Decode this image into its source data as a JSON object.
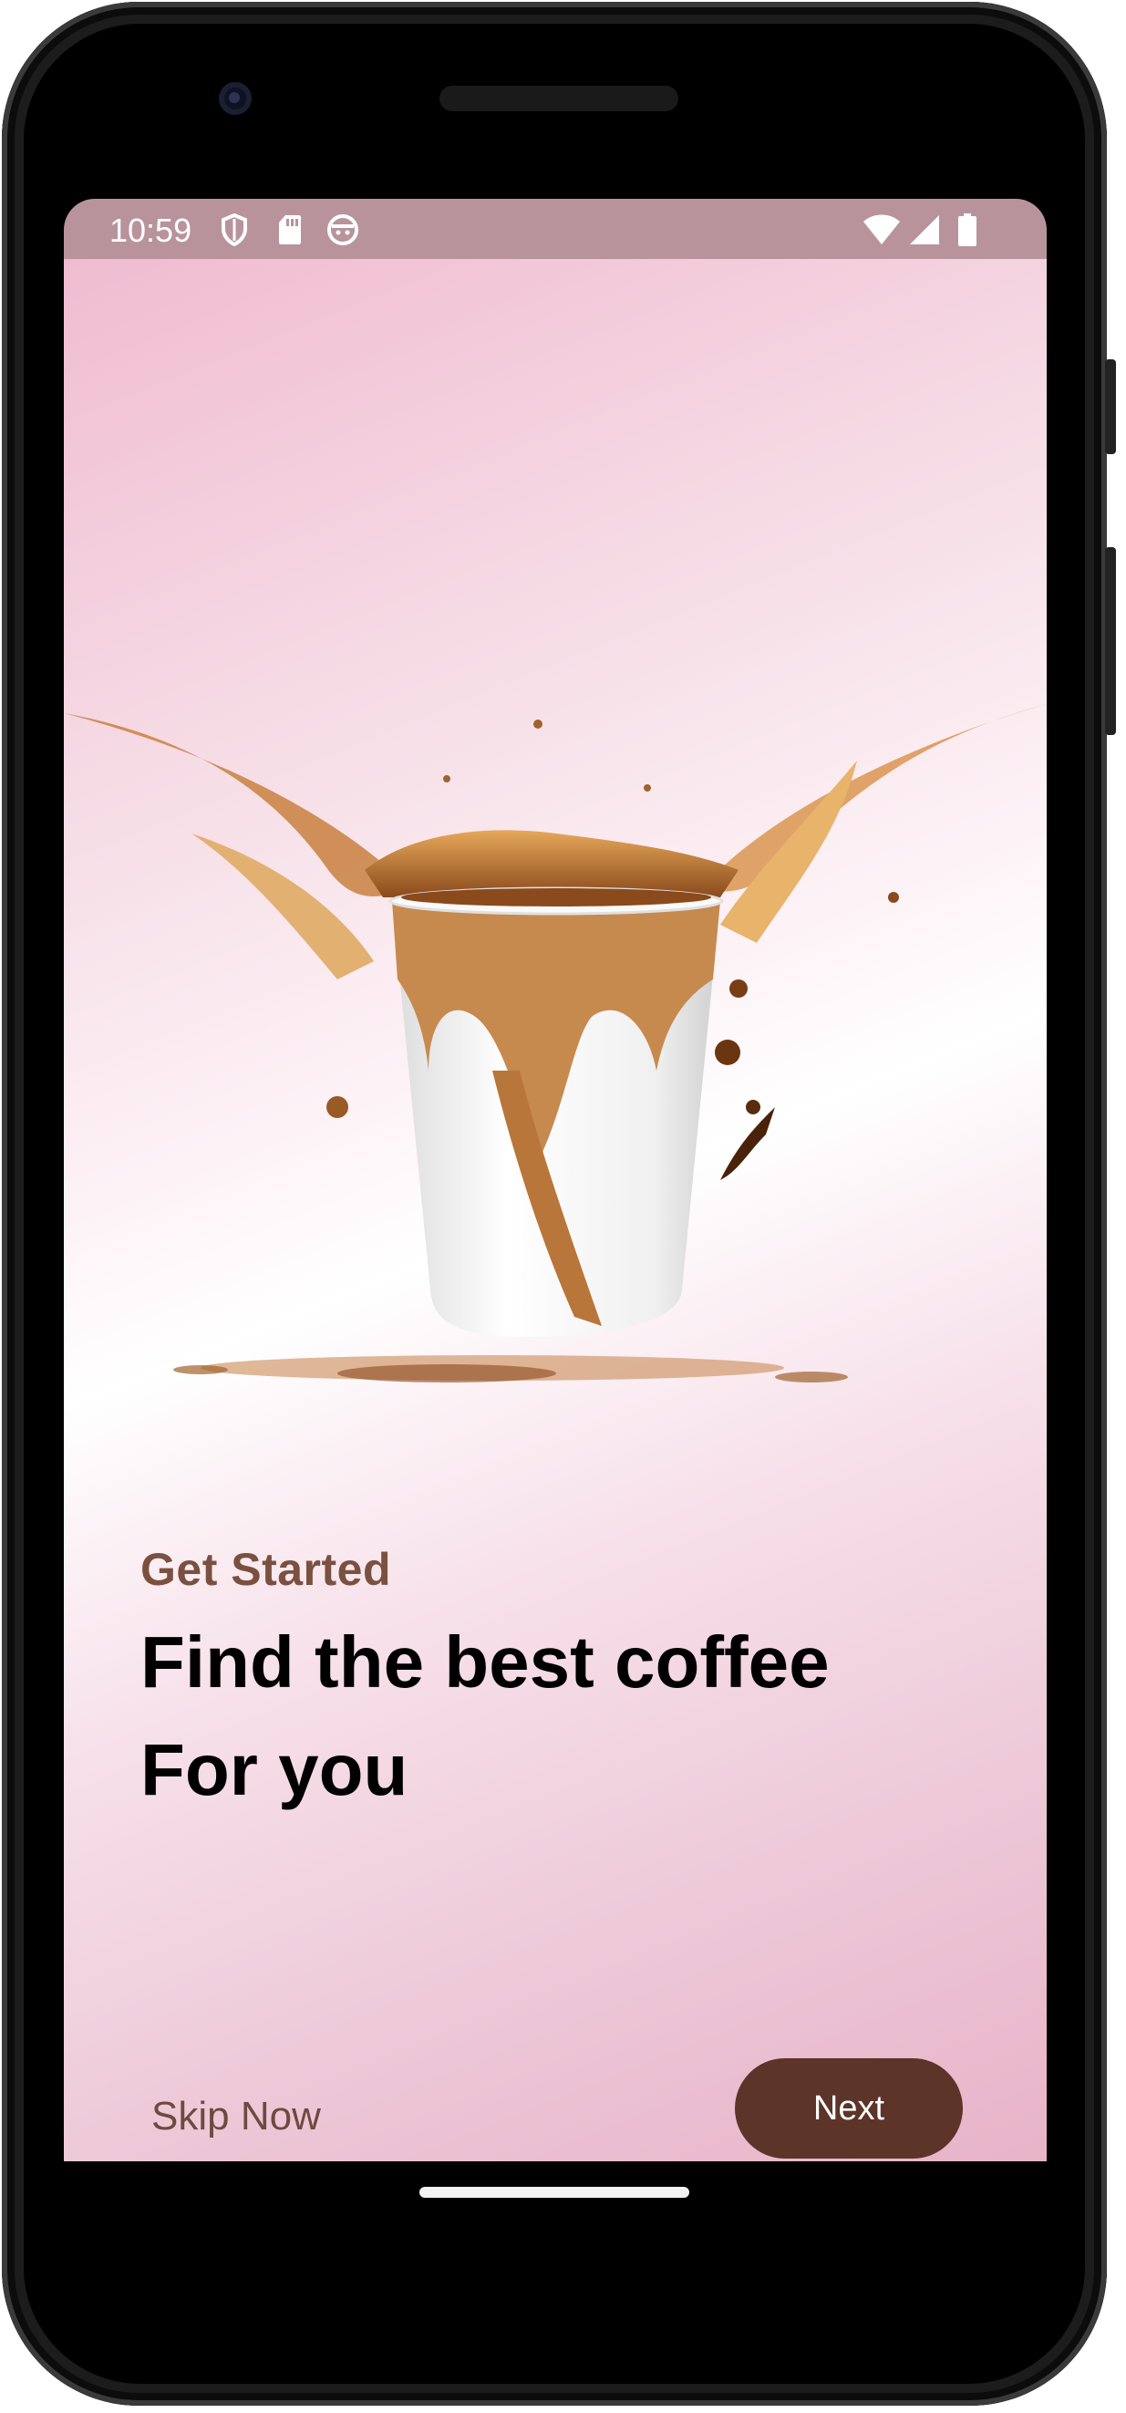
{
  "status_bar": {
    "time": "10:59",
    "left_icons": [
      "shield-icon",
      "sd-card-icon",
      "face-icon"
    ],
    "right_icons": [
      "wifi-icon",
      "cellular-signal-icon",
      "battery-icon"
    ]
  },
  "onboarding": {
    "eyebrow": "Get Started",
    "headline_line1": "Find the best coffee",
    "headline_line2": "For you",
    "skip_label": "Skip Now",
    "next_label": "Next",
    "hero_image": "coffee-cup-splash-illustration"
  },
  "colors": {
    "status_bar": "#b9939c",
    "eyebrow": "#7b5040",
    "headline": "#000000",
    "skip": "#6f4a3f",
    "next_button": "#5c3428",
    "background_pink": "#f0bcd0"
  }
}
